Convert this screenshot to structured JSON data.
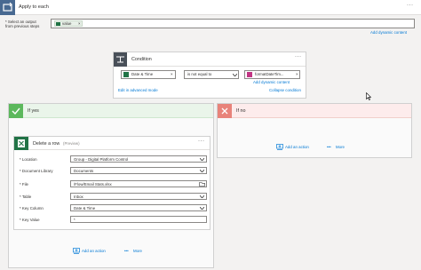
{
  "apply": {
    "title": "Apply to each",
    "select_label": "* Select an output from previous steps",
    "token": "value",
    "add_dynamic": "Add dynamic content",
    "more": "···"
  },
  "condition": {
    "title": "Condition",
    "left_token": "Date & Time",
    "operator": "is not equal to",
    "right_token": "formatDateTim...",
    "add_dynamic": "Add dynamic content",
    "edit_advanced": "Edit in advanced mode",
    "collapse": "Collapse condition",
    "more": "···"
  },
  "if_yes": {
    "label": "If yes"
  },
  "if_no": {
    "label": "If no",
    "add_action": "Add an action",
    "more": "More"
  },
  "delete_row": {
    "title": "Delete a row",
    "preview": "(Preview)",
    "more": "···",
    "fields": [
      {
        "label": "* Location",
        "value": "Group - Digital Platform Control",
        "kind": "dropdown"
      },
      {
        "label": "* Document Library",
        "value": "Documents",
        "kind": "dropdown"
      },
      {
        "label": "* File",
        "value": "/Flow/Email Stats.xlsx",
        "kind": "folder"
      },
      {
        "label": "* Table",
        "value": "Inbox",
        "kind": "dropdown"
      },
      {
        "label": "* Key Column",
        "value": "Date & Time",
        "kind": "dropdown"
      },
      {
        "label": "* Key Value",
        "value": "*",
        "kind": "text"
      }
    ]
  },
  "yes_footer": {
    "add_action": "Add an action",
    "more": "More"
  },
  "colors": {
    "loop_header": "#486991",
    "condition_header": "#484f58",
    "yes_green": "#5cb85c",
    "no_red": "#e8837a",
    "excel_green": "#217346",
    "link_blue": "#0078d4",
    "token_pink": "#c13584"
  }
}
